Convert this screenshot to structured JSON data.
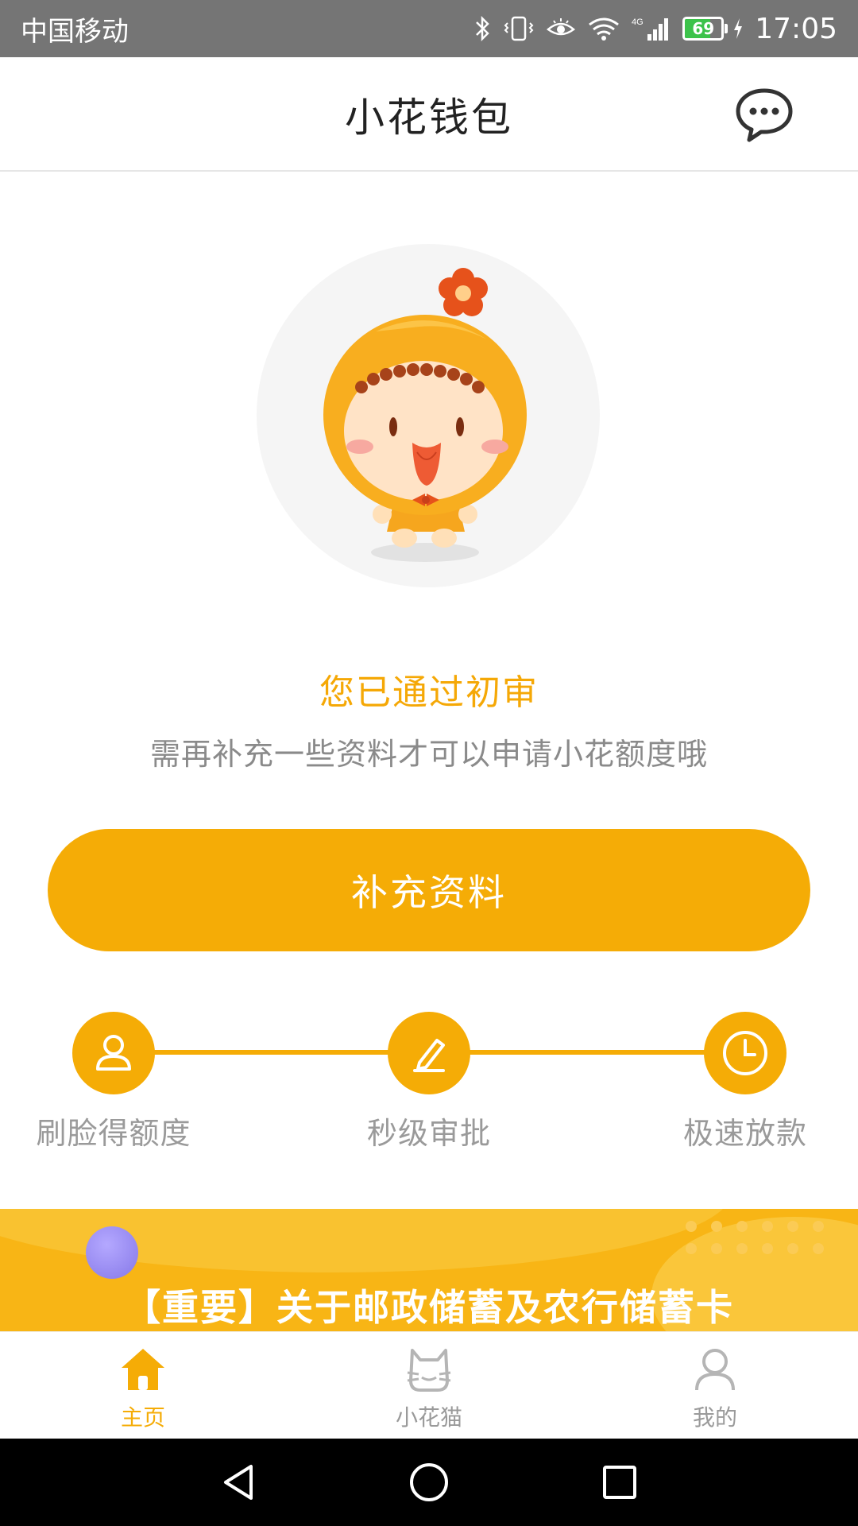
{
  "status_bar": {
    "carrier": "中国移动",
    "network": "4G",
    "battery_level": "69",
    "time": "17:05"
  },
  "header": {
    "title": "小花钱包",
    "message_icon": "chat-bubble-icon"
  },
  "main": {
    "status_title": "您已通过初审",
    "status_subtitle": "需再补充一些资料才可以申请小花额度哦",
    "action_button": "补充资料"
  },
  "steps": [
    {
      "label": "刷脸得额度",
      "icon": "user-icon"
    },
    {
      "label": "秒级审批",
      "icon": "pen-icon"
    },
    {
      "label": "极速放款",
      "icon": "clock-icon"
    }
  ],
  "banner": {
    "text": "【重要】关于邮政储蓄及农行储蓄卡"
  },
  "tab_bar": {
    "tabs": [
      {
        "label": "主页",
        "icon": "home-icon",
        "active": true
      },
      {
        "label": "小花猫",
        "icon": "cat-icon",
        "active": false
      },
      {
        "label": "我的",
        "icon": "person-icon",
        "active": false
      }
    ]
  },
  "colors": {
    "accent": "#f5ac06",
    "status_bar": "#757575",
    "text_gray": "#8a8a8a",
    "tab_inactive": "#9a9a9a"
  }
}
